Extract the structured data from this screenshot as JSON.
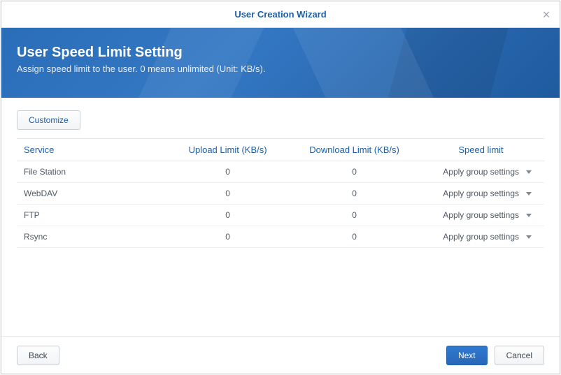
{
  "window": {
    "title": "User Creation Wizard"
  },
  "banner": {
    "heading": "User Speed Limit Setting",
    "desc": "Assign speed limit to the user. 0 means unlimited (Unit: KB/s)."
  },
  "toolbar": {
    "customize": "Customize"
  },
  "table": {
    "headers": {
      "service": "Service",
      "upload": "Upload Limit (KB/s)",
      "download": "Download Limit (KB/s)",
      "speed": "Speed limit"
    },
    "rows": [
      {
        "service": "File Station",
        "upload": "0",
        "download": "0",
        "speed": "Apply group settings"
      },
      {
        "service": "WebDAV",
        "upload": "0",
        "download": "0",
        "speed": "Apply group settings"
      },
      {
        "service": "FTP",
        "upload": "0",
        "download": "0",
        "speed": "Apply group settings"
      },
      {
        "service": "Rsync",
        "upload": "0",
        "download": "0",
        "speed": "Apply group settings"
      }
    ]
  },
  "footer": {
    "back": "Back",
    "next": "Next",
    "cancel": "Cancel"
  }
}
